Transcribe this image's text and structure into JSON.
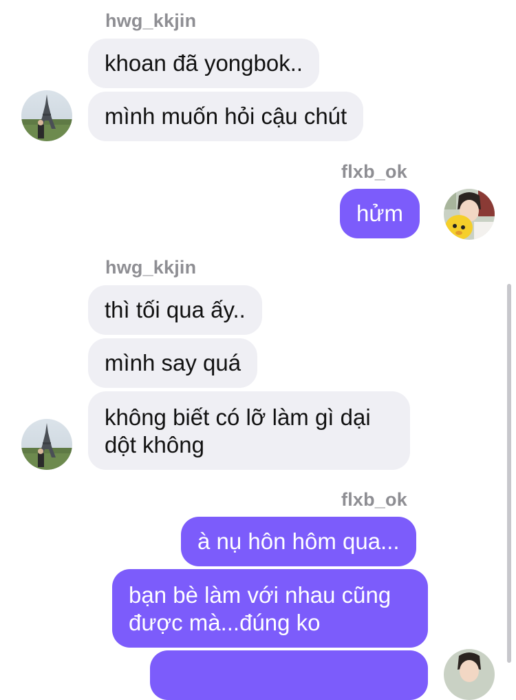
{
  "conversation": {
    "other_user": "hwg_kkjin",
    "self_user": "flxb_ok",
    "groups": [
      {
        "sender": "hwg_kkjin",
        "messages": [
          "khoan đã yongbok..",
          "mình muốn hỏi cậu chút"
        ]
      },
      {
        "sender": "flxb_ok",
        "messages": [
          "hửm"
        ]
      },
      {
        "sender": "hwg_kkjin",
        "messages": [
          "thì tối qua ấy..",
          "mình say quá",
          "không biết có lỡ làm gì dại dột không"
        ]
      },
      {
        "sender": "flxb_ok",
        "messages": [
          "à nụ hôn hôm qua...",
          "bạn bè làm với nhau cũng được mà...đúng ko",
          ""
        ]
      }
    ]
  },
  "colors": {
    "incoming_bubble": "#efeff4",
    "outgoing_bubble": "#7c5cfb",
    "sender_name": "#8e8e93"
  },
  "icons": {
    "other_avatar": "eiffel-tower-photo-avatar",
    "self_avatar": "person-with-yellow-plush-avatar"
  }
}
